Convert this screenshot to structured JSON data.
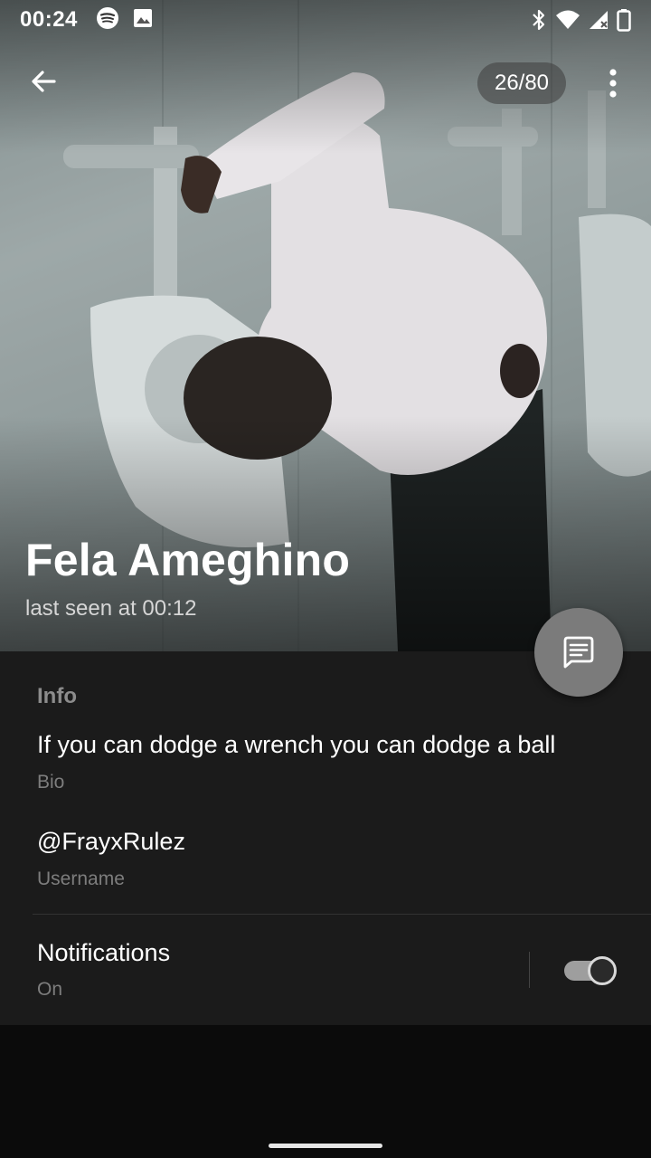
{
  "status_bar": {
    "time": "00:24",
    "left_icons": [
      "spotify-icon",
      "image-icon"
    ],
    "right_icons": [
      "bluetooth-icon",
      "wifi-icon",
      "cellular-signal-icon",
      "battery-icon"
    ]
  },
  "toolbar": {
    "back_icon": "arrow-left-icon",
    "photo_counter": "26/80",
    "more_icon": "more-vertical-icon"
  },
  "profile": {
    "name": "Fela Ameghino",
    "last_seen": "last seen at 00:12"
  },
  "fab": {
    "icon": "message-icon"
  },
  "info": {
    "section_title": "Info",
    "bio": {
      "value": "If you can dodge a wrench you can dodge a ball",
      "label": "Bio"
    },
    "username": {
      "value": "@FrayxRulez",
      "label": "Username"
    },
    "notifications": {
      "title": "Notifications",
      "status": "On",
      "enabled": true
    }
  },
  "colors": {
    "panel_background": "#1b1b1b",
    "secondary_text": "#7d7d7d",
    "fab": "#7b7b7b"
  }
}
